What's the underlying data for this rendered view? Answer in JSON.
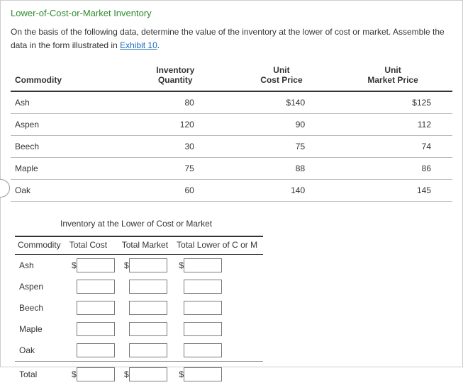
{
  "title": "Lower-of-Cost-or-Market Inventory",
  "intro_part1": "On the basis of the following data, determine the value of the inventory at the lower of cost or market. Assemble the data in the form illustrated in ",
  "intro_link": "Exhibit 10",
  "intro_part2": ".",
  "data_table": {
    "headers": {
      "commodity": "Commodity",
      "qty_l1": "Inventory",
      "qty_l2": "Quantity",
      "cost_l1": "Unit",
      "cost_l2": "Cost Price",
      "mkt_l1": "Unit",
      "mkt_l2": "Market Price"
    },
    "rows": [
      {
        "name": "Ash",
        "qty": "80",
        "cost": "$140",
        "mkt": "$125"
      },
      {
        "name": "Aspen",
        "qty": "120",
        "cost": "90",
        "mkt": "112"
      },
      {
        "name": "Beech",
        "qty": "30",
        "cost": "75",
        "mkt": "74"
      },
      {
        "name": "Maple",
        "qty": "75",
        "cost": "88",
        "mkt": "86"
      },
      {
        "name": "Oak",
        "qty": "60",
        "cost": "140",
        "mkt": "145"
      }
    ]
  },
  "entry_title": "Inventory at the Lower of Cost or Market",
  "entry_table": {
    "headers": {
      "commodity": "Commodity",
      "total_cost": "Total Cost",
      "total_market": "Total Market",
      "total_lower": "Total Lower of C or M"
    },
    "rows": [
      {
        "name": "Ash",
        "prefix_cost": "$",
        "prefix_mkt": "$",
        "prefix_low": "$"
      },
      {
        "name": "Aspen",
        "prefix_cost": "",
        "prefix_mkt": "",
        "prefix_low": ""
      },
      {
        "name": "Beech",
        "prefix_cost": "",
        "prefix_mkt": "",
        "prefix_low": ""
      },
      {
        "name": "Maple",
        "prefix_cost": "",
        "prefix_mkt": "",
        "prefix_low": ""
      },
      {
        "name": "Oak",
        "prefix_cost": "",
        "prefix_mkt": "",
        "prefix_low": ""
      }
    ],
    "total_row": {
      "name": "Total",
      "prefix_cost": "$",
      "prefix_mkt": "$",
      "prefix_low": "$"
    }
  }
}
